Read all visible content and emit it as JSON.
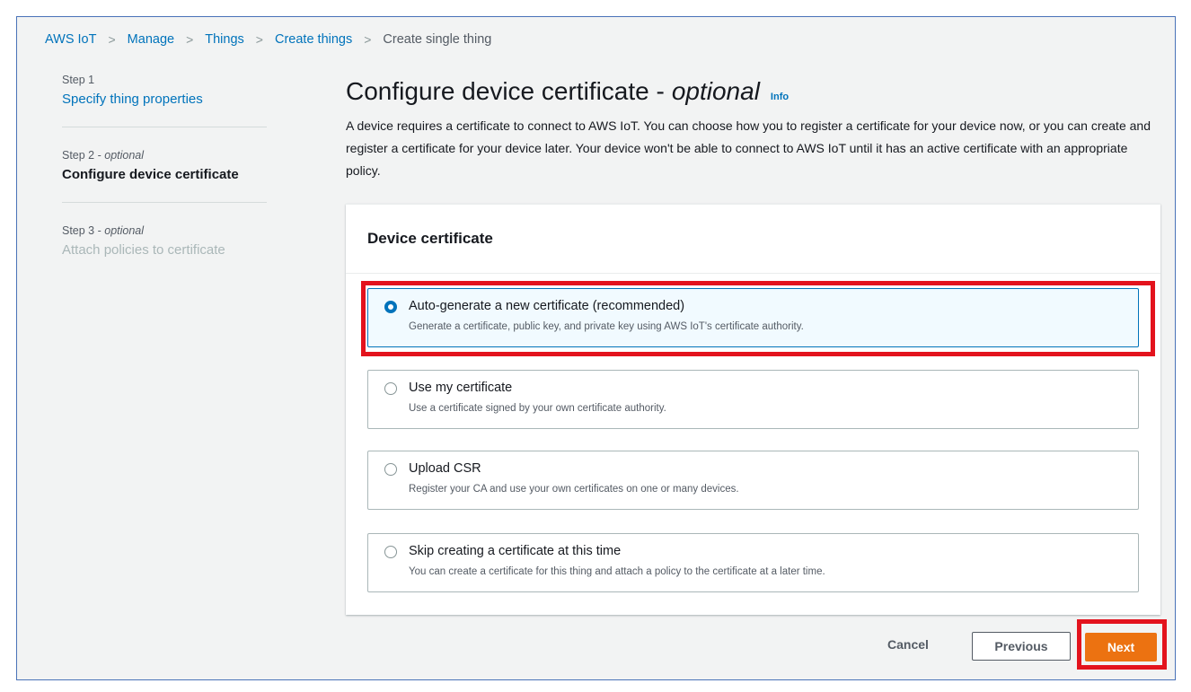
{
  "breadcrumb": {
    "items": [
      "AWS IoT",
      "Manage",
      "Things",
      "Create things"
    ],
    "current": "Create single thing",
    "separator": ">"
  },
  "steps": [
    {
      "number": "Step 1",
      "title": "Specify thing properties"
    },
    {
      "number": "Step 2",
      "optional": "optional",
      "title": "Configure device certificate"
    },
    {
      "number": "Step 3",
      "optional": "optional",
      "title": "Attach policies to certificate"
    }
  ],
  "header": {
    "title": "Configure device certificate -",
    "title_optional": "optional",
    "info": "Info",
    "description": "A device requires a certificate to connect to AWS IoT. You can choose how you to register a certificate for your device now, or you can create and register a certificate for your device later. Your device won't be able to connect to AWS IoT until it has an active certificate with an appropriate policy."
  },
  "card": {
    "title": "Device certificate",
    "options": [
      {
        "label": "Auto-generate a new certificate (recommended)",
        "description": "Generate a certificate, public key, and private key using AWS IoT's certificate authority.",
        "selected": true
      },
      {
        "label": "Use my certificate",
        "description": "Use a certificate signed by your own certificate authority.",
        "selected": false
      },
      {
        "label": "Upload CSR",
        "description": "Register your CA and use your own certificates on one or many devices.",
        "selected": false
      },
      {
        "label": "Skip creating a certificate at this time",
        "description": "You can create a certificate for this thing and attach a policy to the certificate at a later time.",
        "selected": false
      }
    ]
  },
  "footer": {
    "cancel": "Cancel",
    "previous": "Previous",
    "next": "Next"
  },
  "colors": {
    "link": "#0073bb",
    "primary_button": "#ec7211",
    "highlight": "#e3131d",
    "frame_border": "#4a73b8"
  }
}
